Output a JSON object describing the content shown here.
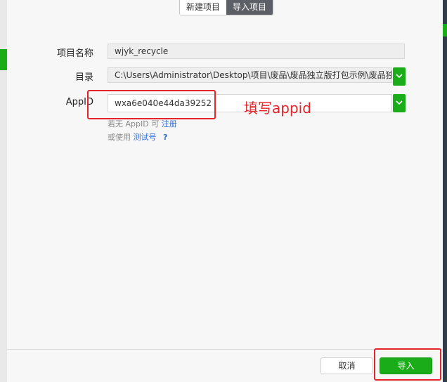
{
  "tabs": [
    {
      "label": "新建项目",
      "active": false
    },
    {
      "label": "导入项目",
      "active": true
    }
  ],
  "form": {
    "project_name_label": "项目名称",
    "project_name_value": "wjyk_recycle",
    "directory_label": "目录",
    "directory_value": "C:\\Users\\Administrator\\Desktop\\项目\\废品\\废品独立版打包示例\\废品独立",
    "appid_label": "AppID",
    "appid_value": "wxa6e040e44da39252",
    "hint_prefix": "若无 AppID 可",
    "hint_register_link": "注册",
    "hint2_prefix": "或使用",
    "hint2_test_link": "测试号",
    "hint2_help": "?"
  },
  "annotation": {
    "text": "填写appid",
    "color": "#e5242a"
  },
  "footer": {
    "cancel_label": "取消",
    "import_label": "导入"
  },
  "colors": {
    "accent_green": "#1aad19",
    "link_blue": "#2c6bd8"
  },
  "icons": {
    "dropdown": "chevron-down-icon",
    "help": "question-icon"
  }
}
